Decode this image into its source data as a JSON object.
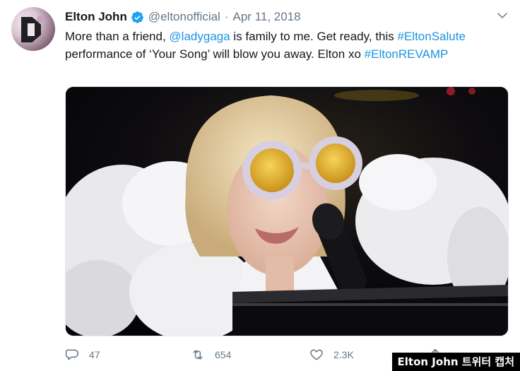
{
  "tweet": {
    "display_name": "Elton John",
    "handle": "@eltonofficial",
    "separator": "·",
    "date": "Apr 11, 2018",
    "text_parts": [
      "More than a friend, ",
      "@ladygaga",
      " is family to me. Get ready, this ",
      "#EltonSalute",
      " performance of ‘Your Song’ will blow you away. Elton xo ",
      "#EltonREVAMP"
    ]
  },
  "actions": {
    "reply_count": "47",
    "retweet_count": "654",
    "like_count": "2.3K"
  },
  "icons": {
    "verified": "verified-badge-icon",
    "caret": "chevron-down-icon",
    "reply": "reply-icon",
    "retweet": "retweet-icon",
    "like": "heart-icon",
    "share": "share-icon"
  },
  "colors": {
    "link": "#1b95e0",
    "verified": "#1da1f2",
    "secondary_text": "#657786"
  },
  "caption": "Elton John 트위터 캡처"
}
